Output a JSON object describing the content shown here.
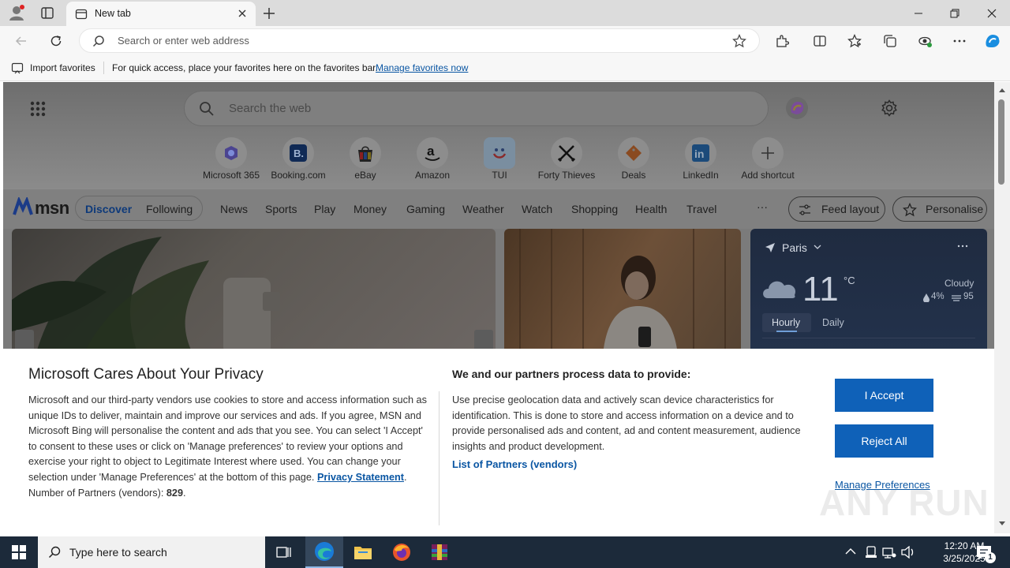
{
  "browser": {
    "tab_title": "New tab",
    "address_placeholder": "Search or enter web address"
  },
  "favorites_bar": {
    "import_label": "Import favorites",
    "hint": "For quick access, place your favorites here on the favorites bar.",
    "manage_link": "Manage favorites now"
  },
  "msn": {
    "search_placeholder": "Search the web",
    "shortcuts": [
      {
        "label": "Microsoft 365",
        "icon": "microsoft-365-icon"
      },
      {
        "label": "Booking.com",
        "icon": "booking-icon"
      },
      {
        "label": "eBay",
        "icon": "ebay-icon"
      },
      {
        "label": "Amazon",
        "icon": "amazon-icon"
      },
      {
        "label": "TUI",
        "icon": "tui-icon"
      },
      {
        "label": "Forty Thieves",
        "icon": "forty-thieves-icon"
      },
      {
        "label": "Deals",
        "icon": "deals-icon"
      },
      {
        "label": "LinkedIn",
        "icon": "linkedin-icon"
      },
      {
        "label": "Add shortcut",
        "icon": "plus-icon"
      }
    ],
    "logo_text": "msn",
    "nav": [
      "Discover",
      "Following",
      "News",
      "Sports",
      "Play",
      "Money",
      "Gaming",
      "Weather",
      "Watch",
      "Shopping",
      "Health",
      "Travel"
    ],
    "more": "···",
    "feed_layout": "Feed layout",
    "personalise": "Personalise",
    "weather": {
      "city": "Paris",
      "temp": "11",
      "unit": "°C",
      "condition": "Cloudy",
      "precip": "4%",
      "humidity": "95",
      "tab_hourly": "Hourly",
      "tab_daily": "Daily"
    }
  },
  "privacy": {
    "title": "Microsoft Cares About Your Privacy",
    "body": "Microsoft and our third-party vendors use cookies to store and access information such as unique IDs to deliver, maintain and improve our services and ads. If you agree, MSN and Microsoft Bing will personalise the content and ads that you see. You can select 'I Accept' to consent to these uses or click on 'Manage preferences' to review your options and exercise your right to object to Legitimate Interest where used.  You can change your selection under 'Manage Preferences' at the bottom of this page.",
    "privacy_link": "Privacy Statement",
    "partners_label": "Number of Partners (vendors):",
    "partners_count": "829",
    "subtitle": "We and our partners process data to provide:",
    "purpose": "Use precise geolocation data and actively scan device characteristics for identification. This is done to store and access information on a device and to provide personalised ads and content, ad and content measurement, audience insights and product development.",
    "partners_link": "List of Partners (vendors)",
    "accept": "I Accept",
    "reject": "Reject All",
    "manage": "Manage Preferences"
  },
  "watermark": "ANY RUN",
  "taskbar": {
    "search_placeholder": "Type here to search",
    "time": "12:20 AM",
    "date": "3/25/2025",
    "notification_count": "1"
  }
}
